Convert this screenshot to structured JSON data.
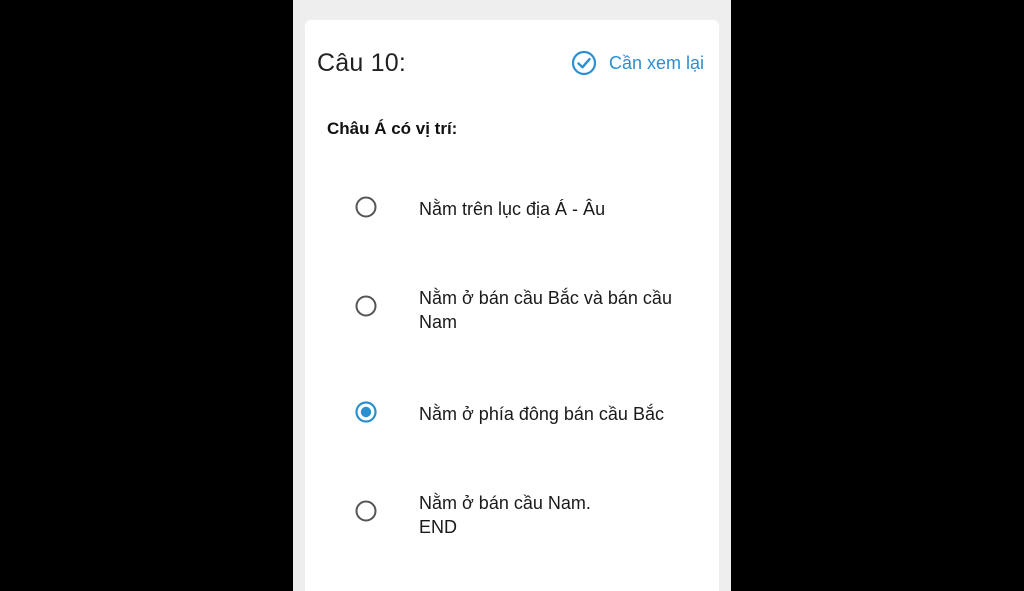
{
  "question": {
    "number_label": "Câu 10:",
    "review_label": "Cần xem lại",
    "review_icon": "check-circle-icon",
    "text": "Châu Á có vị trí:"
  },
  "options": [
    {
      "line1": "Nằm trên lục địa Á - Âu",
      "line2": "",
      "selected": false
    },
    {
      "line1": "Nằm ở bán cầu Bắc và bán cầu",
      "line2": "Nam",
      "selected": false
    },
    {
      "line1": "Nằm ở phía đông bán cầu Bắc",
      "line2": "",
      "selected": true
    },
    {
      "line1": "Nằm ở bán cầu Nam.",
      "line2": "END",
      "selected": false
    }
  ],
  "colors": {
    "accent": "#2b8fd0",
    "radio_unselected": "#555555",
    "radio_selected": "#2b8fd0"
  }
}
